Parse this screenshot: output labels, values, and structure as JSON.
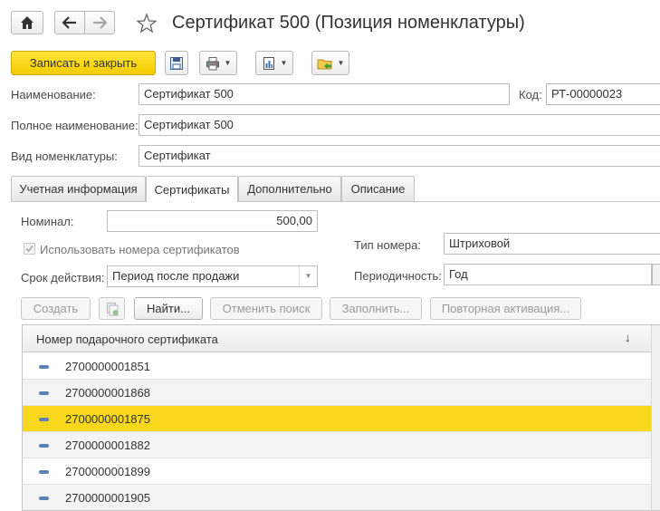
{
  "window": {
    "title": "Сертификат 500 (Позиция номенклатуры)"
  },
  "toolbar": {
    "save_close_label": "Записать и закрыть"
  },
  "fields": {
    "name_label": "Наименование:",
    "name_value": "Сертификат 500",
    "code_label": "Код:",
    "code_value": "РТ-00000023",
    "full_name_label": "Полное наименование:",
    "full_name_value": "Сертификат 500",
    "type_label": "Вид номенклатуры:",
    "type_value": "Сертификат"
  },
  "tabs": [
    {
      "label": "Учетная информация"
    },
    {
      "label": "Сертификаты"
    },
    {
      "label": "Дополнительно"
    },
    {
      "label": "Описание"
    }
  ],
  "cert": {
    "nominal_label": "Номинал:",
    "nominal_value": "500,00",
    "use_numbers_label": "Использовать номера сертификатов",
    "number_type_label": "Тип номера:",
    "number_type_value": "Штриховой",
    "validity_label": "Срок действия:",
    "validity_value": "Период после продажи",
    "periodicity_label": "Периодичность:",
    "periodicity_value": "Год"
  },
  "actions": {
    "create": "Создать",
    "find": "Найти...",
    "cancel_search": "Отменить поиск",
    "fill": "Заполнить...",
    "reactivate": "Повторная активация..."
  },
  "table": {
    "column_header": "Номер подарочного сертификата",
    "sort_indicator": "↓",
    "rows": [
      "2700000001851",
      "2700000001868",
      "2700000001875",
      "2700000001882",
      "2700000001899",
      "2700000001905"
    ],
    "selected_index": 2
  },
  "colors": {
    "accent_yellow": "#f8d71c",
    "icon_blue": "#5b82b8"
  },
  "icons": {
    "home": "home-icon",
    "back": "arrow-left-icon",
    "forward": "arrow-right-icon",
    "favorite": "star-icon",
    "save": "floppy-disk-icon",
    "print": "printer-icon",
    "report": "report-icon",
    "related": "folder-arrow-icon"
  }
}
